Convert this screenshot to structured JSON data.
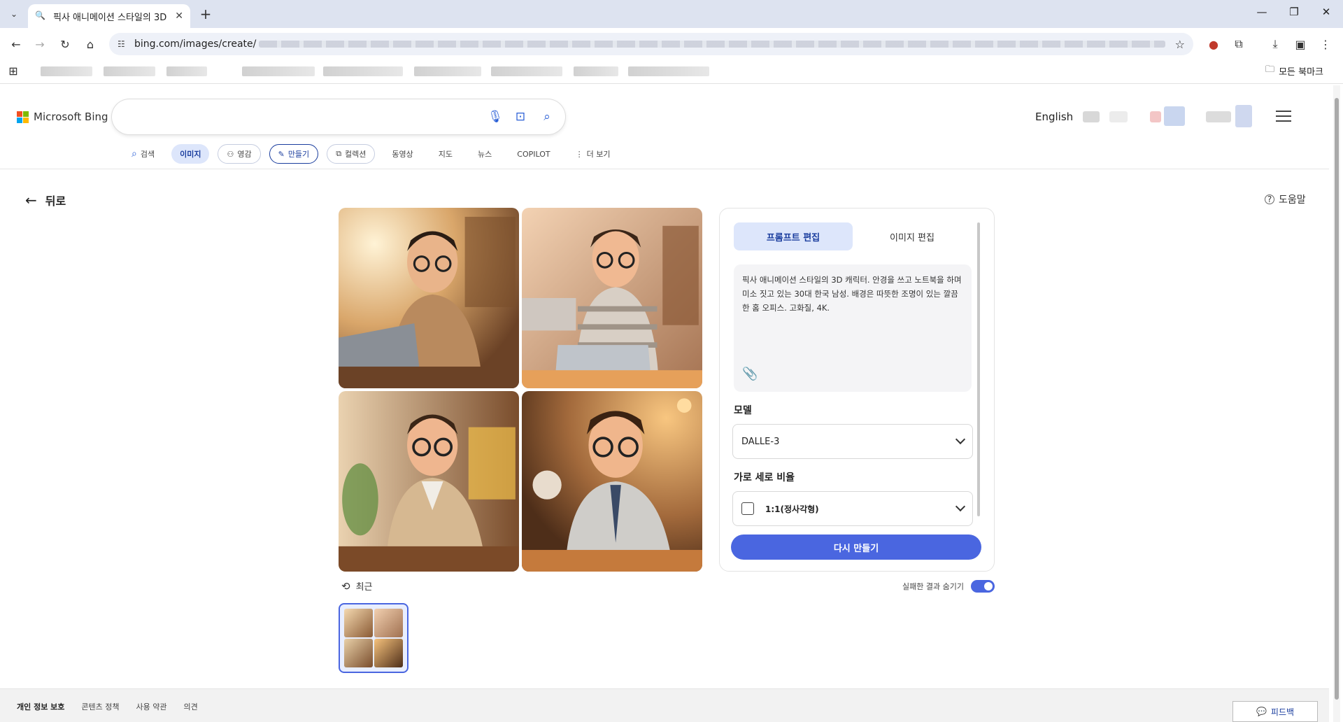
{
  "browser": {
    "tab_title": "픽사 애니메이션 스타일의 3D",
    "url": "bing.com/images/create/",
    "bookmarks_all": "모든 북마크"
  },
  "header": {
    "logo_text": "Microsoft Bing",
    "language": "English",
    "nav": [
      {
        "label": "검색"
      },
      {
        "label": "이미지"
      },
      {
        "label": "영감"
      },
      {
        "label": "만들기"
      },
      {
        "label": "컬렉션"
      },
      {
        "label": "동영상"
      },
      {
        "label": "지도"
      },
      {
        "label": "뉴스"
      },
      {
        "label": "COPILOT"
      },
      {
        "label": "더 보기"
      }
    ]
  },
  "page": {
    "back_label": "뒤로",
    "help_label": "도움말"
  },
  "panel": {
    "tabs": [
      {
        "label": "프롬프트 편집"
      },
      {
        "label": "이미지 편집"
      }
    ],
    "prompt": "픽사 애니메이션 스타일의 3D 캐릭터. 안경을 쓰고 노트북을 하며 미소 짓고 있는 30대 한국 남성. 배경은 따뜻한 조명이 있는 깔끔한 홈 오피스. 고화질, 4K.",
    "model_label": "모델",
    "model_value": "DALLE-3",
    "ratio_label": "가로 세로 비율",
    "ratio_value": "1:1(정사각형)",
    "regen_button": "다시 만들기"
  },
  "history": {
    "recent_label": "최근",
    "hide_failed_label": "실패한 결과 숨기기"
  },
  "footer": {
    "links": [
      {
        "label": "개인 정보 보호"
      },
      {
        "label": "콘텐츠 정책"
      },
      {
        "label": "사용 약관"
      },
      {
        "label": "의견"
      }
    ],
    "feedback": "피드백"
  },
  "colors": {
    "accent": "#4a66e0",
    "nav_active_bg": "#dde6fb"
  }
}
